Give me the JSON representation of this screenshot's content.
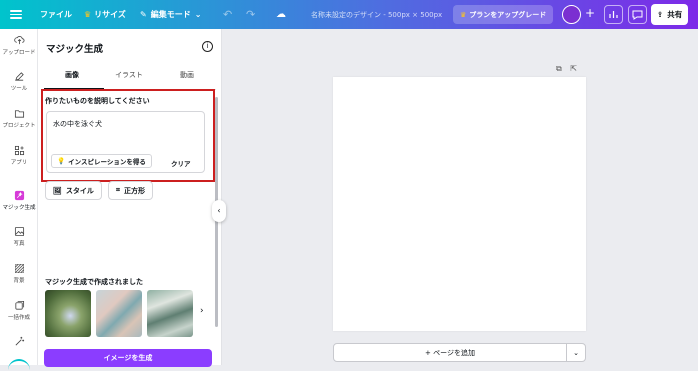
{
  "topbar": {
    "file_label": "ファイル",
    "resize_label": "リサイズ",
    "edit_mode_label": "編集モード",
    "design_title": "名称未設定のデザイン - 500px × 500px",
    "upgrade_label": "プランをアップグレード",
    "share_label": "共有",
    "gradient_colors": [
      "#00c4cc",
      "#4f6de0",
      "#7d2ae8"
    ]
  },
  "rail": {
    "items": [
      {
        "label": "アップロード",
        "icon": "upload-icon"
      },
      {
        "label": "ツール",
        "icon": "pen-tool-icon"
      },
      {
        "label": "プロジェクト",
        "icon": "folder-icon"
      },
      {
        "label": "アプリ",
        "icon": "apps-icon"
      },
      {
        "label": "マジック生成",
        "icon": "magic-generate-icon"
      },
      {
        "label": "写真",
        "icon": "photo-icon"
      },
      {
        "label": "背景",
        "icon": "background-icon"
      },
      {
        "label": "一括作成",
        "icon": "bulk-create-icon"
      }
    ]
  },
  "panel": {
    "title": "マジック生成",
    "tabs": [
      "画像",
      "イラスト",
      "動画"
    ],
    "active_tab": "画像",
    "prompt_label": "作りたいものを説明してください",
    "prompt_value": "水の中を泳ぐ犬",
    "inspire_label": "インスピレーションを得る",
    "clear_label": "クリア",
    "style_label": "スタイル",
    "aspect_label": "正方形",
    "recent_label": "マジック生成で作成されました",
    "generate_label": "イメージを生成",
    "accent_color": "#8b3dff",
    "highlight_color": "#cc1f1f"
  },
  "canvas": {
    "add_page_label": "+ ページを追加"
  }
}
